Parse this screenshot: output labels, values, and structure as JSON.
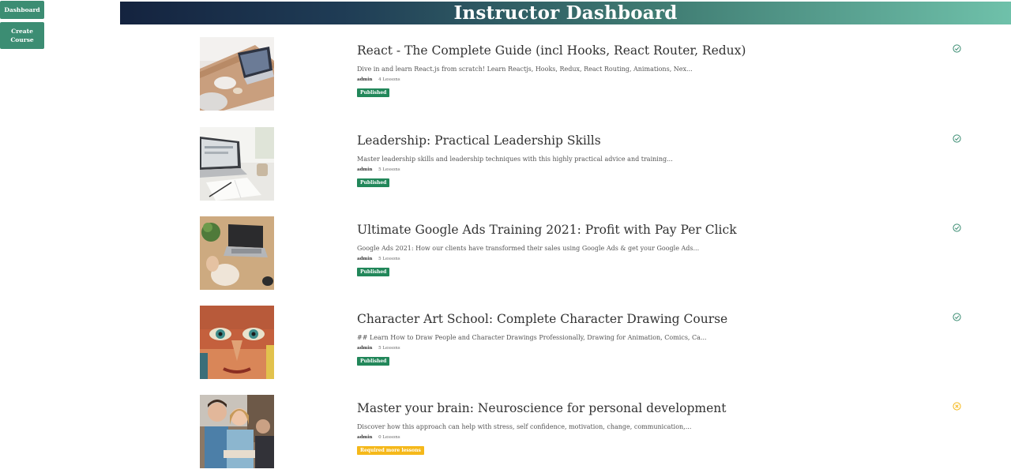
{
  "sidebar": {
    "dashboard_label": "Dashboard",
    "create_line1": "Create",
    "create_line2": "Course"
  },
  "header": {
    "title": "Instructor Dashboard"
  },
  "courses": [
    {
      "title": "React - The Complete Guide (incl Hooks, React Router, Redux)",
      "description": "Dive in and learn React.js from scratch! Learn Reactjs, Hooks, Redux, React Routing, Animations, Nex...",
      "author": "admin",
      "lessons": "4 Lessons",
      "status": "Published",
      "status_icon": "check-circle-icon"
    },
    {
      "title": "Leadership: Practical Leadership Skills",
      "description": "Master leadership skills and leadership techniques with this highly practical advice and training...",
      "author": "admin",
      "lessons": "5 Lessons",
      "status": "Published",
      "status_icon": "check-circle-icon"
    },
    {
      "title": "Ultimate Google Ads Training 2021: Profit with Pay Per Click",
      "description": "Google Ads 2021: How our clients have transformed their sales using Google Ads & get your Google Ads...",
      "author": "admin",
      "lessons": "5 Lessons",
      "status": "Published",
      "status_icon": "check-circle-icon"
    },
    {
      "title": "Character Art School: Complete Character Drawing Course",
      "description": "## Learn How to Draw People and Character Drawings Professionally, Drawing for Animation, Comics, Ca...",
      "author": "admin",
      "lessons": "5 Lessons",
      "status": "Published",
      "status_icon": "check-circle-icon"
    },
    {
      "title": "Master your brain: Neuroscience for personal development",
      "description": "Discover how this approach can help with stress, self confidence, motivation, change, communication,...",
      "author": "admin",
      "lessons": "0 Lessons",
      "status": "Required more lessons",
      "status_icon": "x-circle-icon"
    }
  ],
  "colors": {
    "sidebar": "#3c8d73",
    "published": "#22875a",
    "warning": "#f5b81a"
  }
}
